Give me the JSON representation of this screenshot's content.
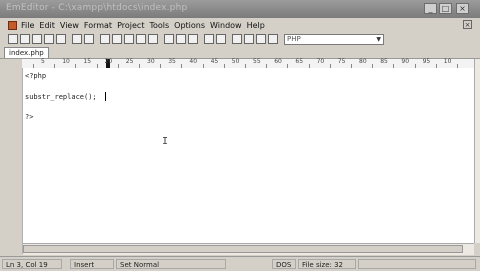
{
  "window": {
    "title": "EmEditor - C:\\xampp\\htdocs\\index.php"
  },
  "menu": {
    "items": [
      "File",
      "Edit",
      "View",
      "Format",
      "Project",
      "Tools",
      "Options",
      "Window",
      "Help"
    ]
  },
  "toolbar": {
    "syntax_mode": "PHP"
  },
  "tab": {
    "filename": "index.php"
  },
  "ruler": {
    "labels": [
      "5",
      "10",
      "15",
      "20",
      "25",
      "30",
      "35",
      "40",
      "45",
      "50",
      "55",
      "60",
      "65",
      "70",
      "75",
      "80",
      "85",
      "90",
      "95",
      "10"
    ]
  },
  "editor": {
    "lines": [
      "<?php",
      "",
      "substr_replace();",
      "",
      "?>"
    ]
  },
  "status": {
    "position": "Ln 3, Col 19",
    "mode": "Insert",
    "style": "Set Normal",
    "line_ending": "DOS",
    "file_size": "File size: 32"
  }
}
